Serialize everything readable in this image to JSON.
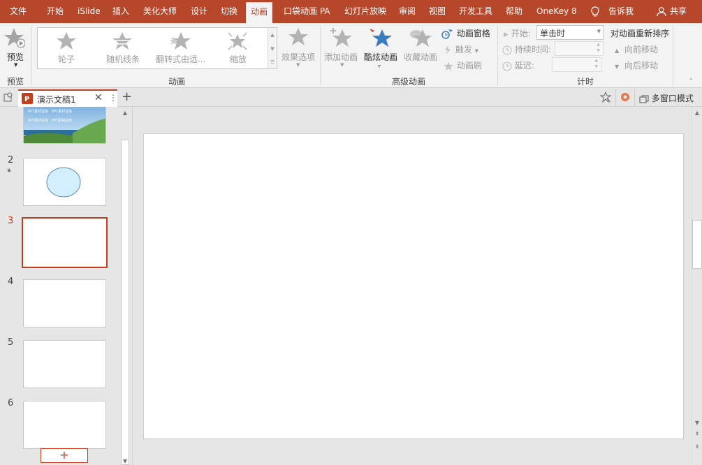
{
  "ribbon_tabs": [
    "文件",
    "开始",
    "iSlide",
    "插入",
    "美化大师",
    "设计",
    "切换",
    "动画",
    "口袋动画 PA",
    "幻灯片放映",
    "审阅",
    "视图",
    "开发工具",
    "帮助",
    "OneKey 8"
  ],
  "active_tab": "动画",
  "tell_me": "告诉我",
  "share": "共享",
  "preview": {
    "label": "预览",
    "group": "预览"
  },
  "gallery": {
    "items": [
      "轮子",
      "随机线条",
      "翻转式由远...",
      "缩放"
    ],
    "effect_options": "效果选项",
    "group": "动画"
  },
  "advanced": {
    "add_animation": "添加动画",
    "cool_animation": "酷炫动画",
    "collect_animation": "收藏动画",
    "animation_pane": "动画窗格",
    "trigger": "触发",
    "animation_painter": "动画刷",
    "group": "高级动画"
  },
  "timing": {
    "start_label": "开始:",
    "start_value": "单击时",
    "duration_label": "持续时间:",
    "delay_label": "延迟:",
    "reorder_title": "对动画重新排序",
    "move_earlier": "向前移动",
    "move_later": "向后移动",
    "group": "计时"
  },
  "document": {
    "tab_title": "演示文稿1",
    "multi_window": "多窗口模式"
  },
  "slides": [
    {
      "number": "",
      "thumb_text": [
        "PPT素材宝库",
        "PPT素材宝库",
        "PPT素材宝库",
        "PPT素材宝库"
      ]
    },
    {
      "number": "2"
    },
    {
      "number": "3"
    },
    {
      "number": "4"
    },
    {
      "number": "5"
    },
    {
      "number": "6"
    }
  ],
  "active_slide": "3",
  "colors": {
    "accent": "#b7472a",
    "selection": "#c43e1c",
    "star_blue": "#3b7bc0"
  }
}
